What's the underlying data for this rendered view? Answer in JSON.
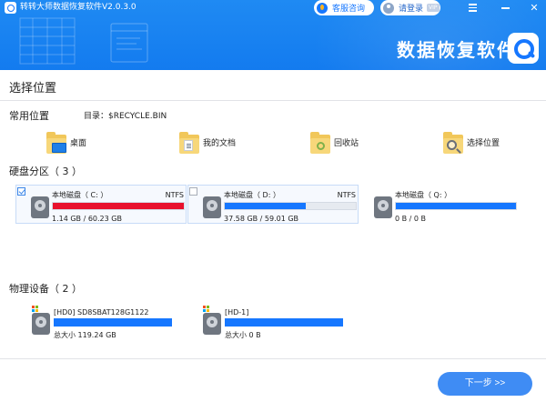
{
  "titlebar": {
    "app_title": "转转大师数据恢复软件V2.0.3.0",
    "support_label": "客服咨询",
    "login_label": "请登录",
    "vip_badge": "VIP",
    "menu_icon": "menu-icon",
    "minimize_icon": "minimize-icon",
    "close_glyph": "✕"
  },
  "brand": {
    "text": "数据恢复软件",
    "logo_icon": "search-logo-icon"
  },
  "page": {
    "title": "选择位置"
  },
  "common": {
    "title": "常用位置",
    "dir_label": "目录：$RECYCLE.BIN",
    "items": [
      {
        "label": "桌面",
        "icon": "desktop-folder-icon"
      },
      {
        "label": "我的文档",
        "icon": "documents-folder-icon"
      },
      {
        "label": "回收站",
        "icon": "recycle-folder-icon"
      },
      {
        "label": "选择位置",
        "icon": "browse-folder-icon"
      }
    ]
  },
  "partitions": {
    "title": "硬盘分区（ 3 ）",
    "items": [
      {
        "name": "本地磁盘（ C: ）",
        "fs": "NTFS",
        "size": "1.14 GB / 60.23 GB",
        "used_fraction": 1.0,
        "bar_color": "#e8112d",
        "checked": true
      },
      {
        "name": "本地磁盘（ D: ）",
        "fs": "NTFS",
        "size": "37.58 GB / 59.01 GB",
        "used_fraction": 0.62,
        "bar_color": "#1677ff",
        "checked": false
      },
      {
        "name": "本地磁盘（ Q: ）",
        "fs": "",
        "size": "0 B / 0 B",
        "used_fraction": 1.0,
        "bar_color": "#1677ff",
        "checked": false
      }
    ]
  },
  "devices": {
    "title": "物理设备（ 2 ）",
    "items": [
      {
        "name": "[HD0] SD8SBAT128G1122",
        "size": "总大小 119.24 GB"
      },
      {
        "name": "[HD-1]",
        "size": "总大小 0 B"
      }
    ]
  },
  "footer": {
    "next_label": "下一步 >>"
  },
  "colors": {
    "header_blue": "#1677ff",
    "accent_red": "#e8112d",
    "button_blue": "#3f8cf4"
  }
}
